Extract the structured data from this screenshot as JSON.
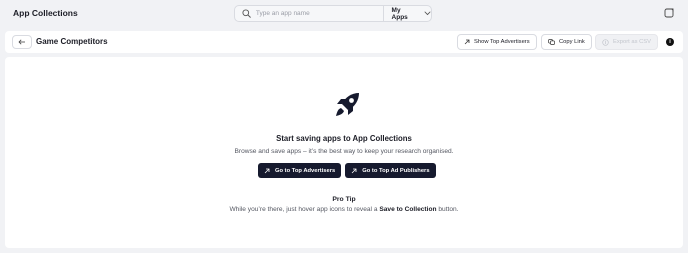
{
  "header": {
    "title": "App Collections",
    "search": {
      "placeholder": "Type an app name",
      "value": ""
    },
    "my_apps_label": "My Apps",
    "icons": {
      "search": "search-icon",
      "dropdown": "chevron-down-icon",
      "window": "window-icon"
    }
  },
  "toolbar": {
    "title": "Game Competitors",
    "back_icon": "arrow-left-icon",
    "buttons": {
      "show_top_advertisers": "Show Top Advertisers",
      "copy_link": "Copy Link",
      "export_csv": "Export as CSV"
    },
    "info_label": "i"
  },
  "empty_state": {
    "icon": "rocket-icon",
    "title": "Start saving apps to App Collections",
    "subtitle": "Browse and save apps – it’s the best way to keep your research organised.",
    "cta_advertisers": "Go to Top Advertisers",
    "cta_publishers": "Go to Top Ad Publishers",
    "tip_title": "Pro Tip",
    "tip_before": "While you’re there, just hover app icons to reveal a ",
    "tip_emphasis": "Save to Collection",
    "tip_after": " button."
  },
  "colors": {
    "background": "#f1f2f5",
    "panel": "#ffffff",
    "primary_button": "#161a2e",
    "text": "#1c1d26",
    "muted_text": "#555862"
  }
}
